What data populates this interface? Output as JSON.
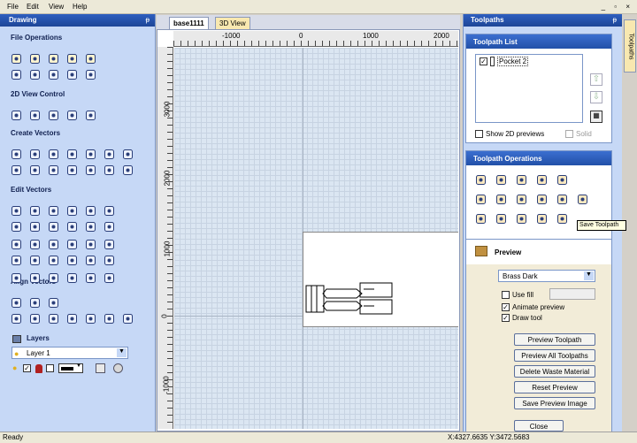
{
  "menu": {
    "file": "File",
    "edit": "Edit",
    "view": "View",
    "help": "Help"
  },
  "window_controls": "_ ▫ ×",
  "drawing_panel": {
    "title": "Drawing",
    "pin": "ᵽ",
    "sections": {
      "file_operations": "File Operations",
      "view_control": "2D View Control",
      "create_vectors": "Create Vectors",
      "edit_vectors": "Edit Vectors",
      "align_vectors": "Align Vectors",
      "layers": "Layers"
    },
    "layer_select": "Layer 1"
  },
  "tabs": {
    "base": "base1111",
    "view3d": "3D View"
  },
  "ruler": {
    "top": [
      "-1000",
      "0",
      "1000",
      "2000"
    ],
    "left": [
      "3000",
      "2000",
      "1000",
      "0",
      "-1000"
    ]
  },
  "toolpaths_panel": {
    "title": "Toolpaths",
    "side_tab": "Toolpaths",
    "list_title": "Toolpath List",
    "item": "Pocket 2",
    "show_2d": "Show 2D previews",
    "solid": "Solid",
    "ops_title": "Toolpath Operations",
    "tooltip": "Save Toolpath",
    "preview_title": "Preview",
    "material": "Brass Dark",
    "use_fill": "Use fill",
    "animate": "Animate preview",
    "draw_tool": "Draw tool",
    "buttons": {
      "preview_toolpath": "Preview Toolpath",
      "preview_all": "Preview All Toolpaths",
      "delete_waste": "Delete Waste Material",
      "reset": "Reset Preview",
      "save_image": "Save Preview Image",
      "close": "Close"
    }
  },
  "status": {
    "left": "Ready",
    "coords": "X:4327.6635 Y:3472.5683"
  },
  "colors": {
    "panel_bg": "#c6d8f6",
    "header": "#2250a8",
    "canvas": "#dbe6f2"
  }
}
